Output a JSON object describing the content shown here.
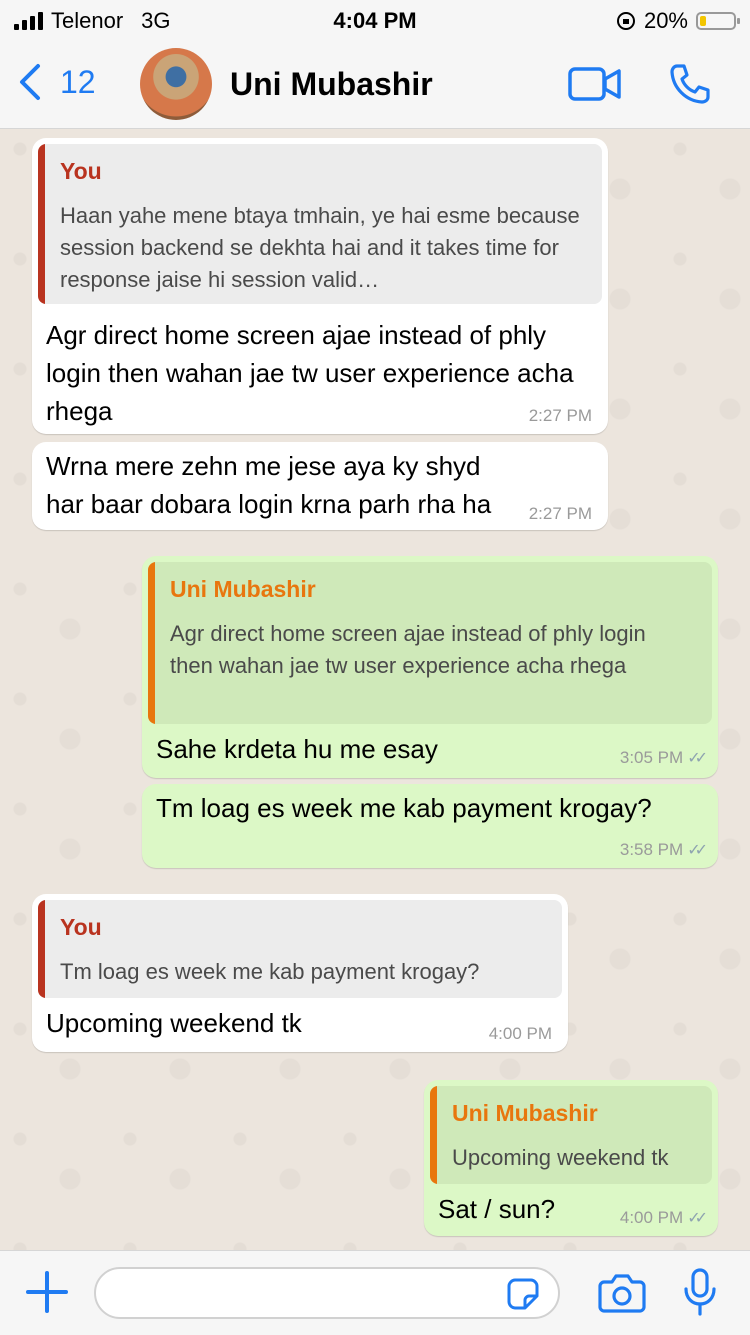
{
  "status": {
    "carrier": "Telenor",
    "network": "3G",
    "time": "4:04 PM",
    "battery_percent": "20%",
    "battery_level": 0.2,
    "battery_color": "#f2c500"
  },
  "header": {
    "back_count": "12",
    "contact_name": "Uni Mubashir",
    "accent": "#1f7bf2"
  },
  "messages": [
    {
      "dir": "in",
      "reply_name": "You",
      "reply_text": "Haan yahe mene btaya tmhain, ye hai esme because session backend se dekhta hai and it takes time for response jaise hi session valid…",
      "text": "Agr direct home screen ajae instead of phly login then wahan jae tw user experience acha rhega",
      "time": "2:27 PM"
    },
    {
      "dir": "in",
      "text": "Wrna mere zehn me jese aya ky shyd har baar dobara login krna parh rha ha",
      "time": "2:27 PM"
    },
    {
      "dir": "out",
      "reply_name": "Uni Mubashir",
      "reply_text": "Agr direct home screen ajae instead of phly login then wahan jae tw user experience acha rhega",
      "text": "Sahe krdeta hu me esay",
      "time": "3:05 PM"
    },
    {
      "dir": "out",
      "text": "Tm loag es week me kab payment krogay?",
      "time": "3:58 PM"
    },
    {
      "dir": "in",
      "reply_name": "You",
      "reply_text": "Tm loag es week me kab payment krogay?",
      "text": "Upcoming weekend tk",
      "time": "4:00 PM"
    },
    {
      "dir": "out",
      "reply_name": "Uni Mubashir",
      "reply_text": "Upcoming weekend tk",
      "text": "Sat / sun?",
      "time": "4:00 PM"
    }
  ],
  "colors": {
    "in_bubble": "#ffffff",
    "out_bubble": "#dcf8c6",
    "reply_you": "#b9331f",
    "reply_contact": "#e8760e"
  },
  "composer": {
    "value": "",
    "placeholder": ""
  }
}
